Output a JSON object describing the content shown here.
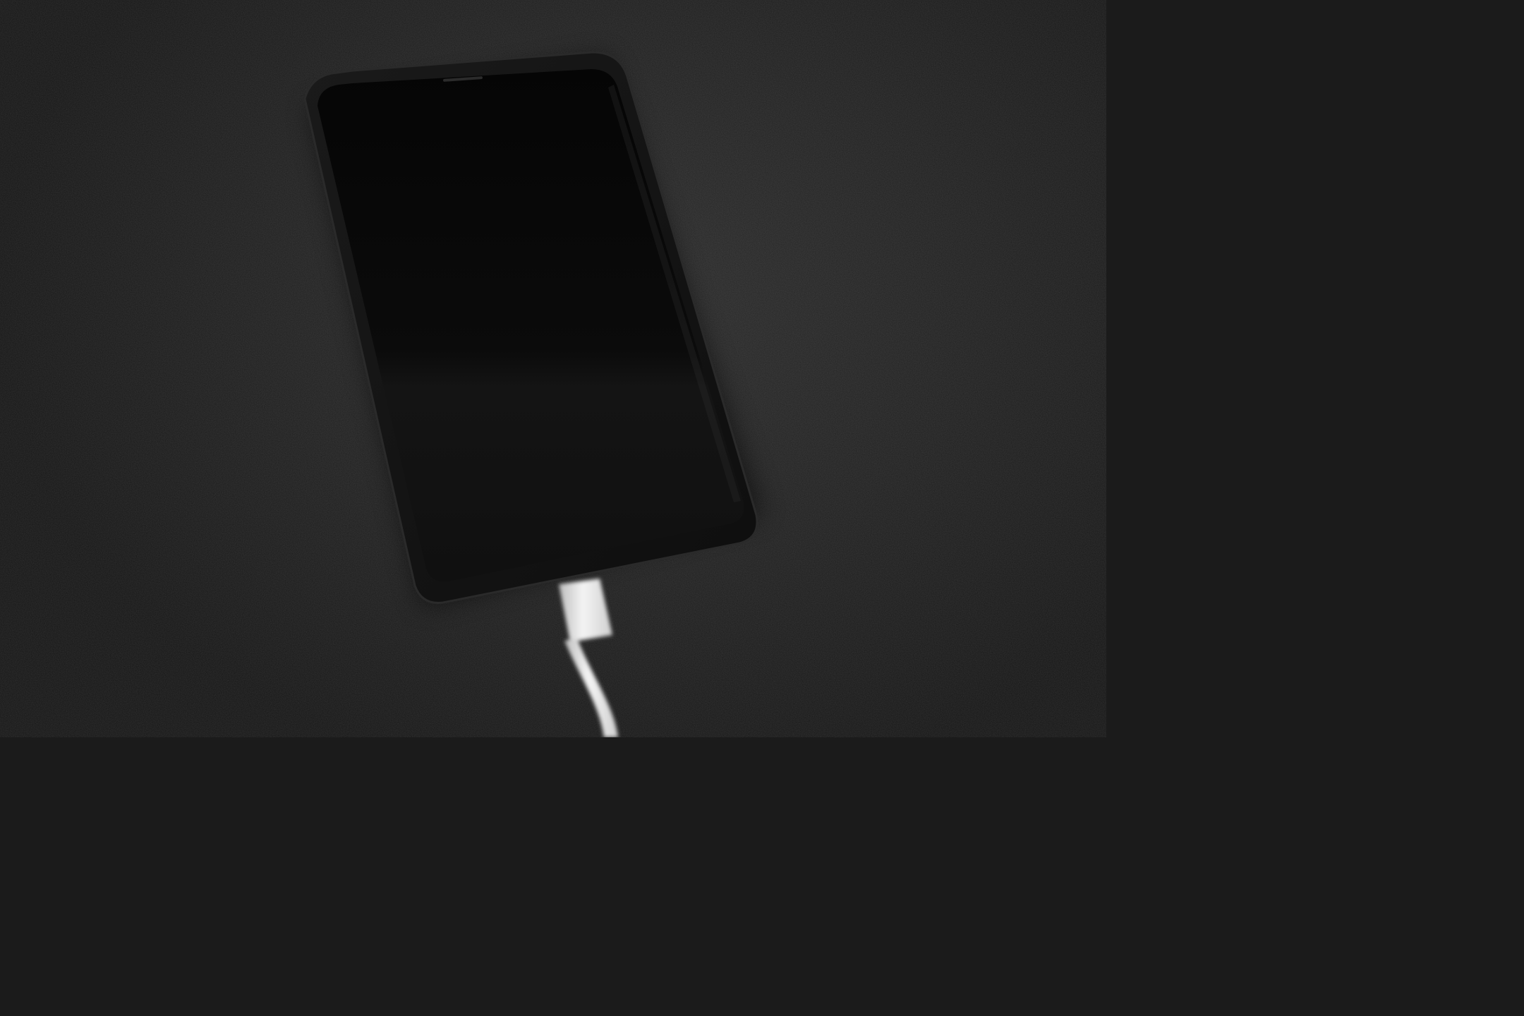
{
  "scene": {
    "subject": "smartphone-charging",
    "colors": {
      "surface": "#1f1f1f",
      "phone_body": "#121212",
      "screen": "#060606",
      "cable": "#e9e9e9"
    }
  }
}
